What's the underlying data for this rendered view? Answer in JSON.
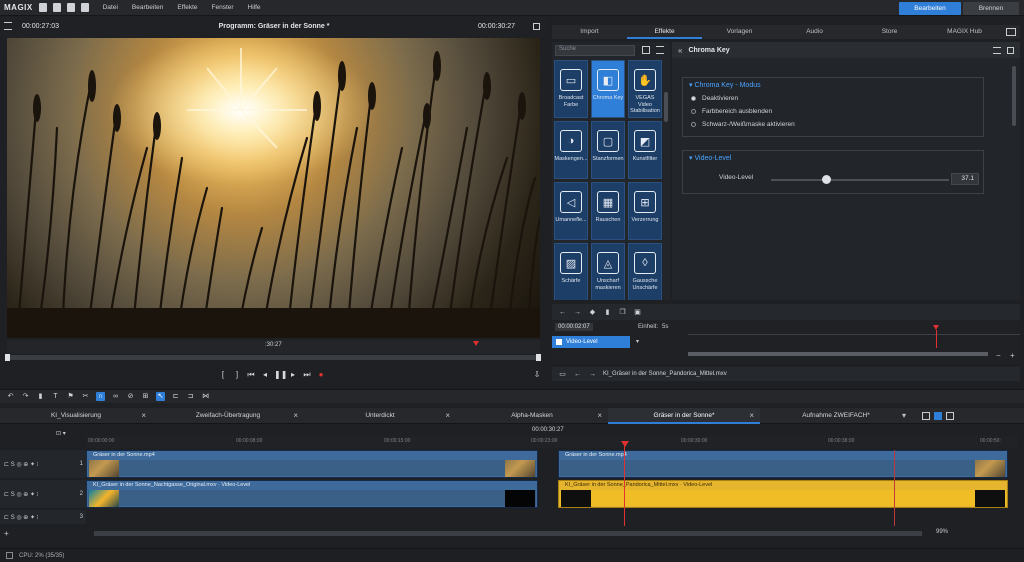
{
  "menubar": {
    "logo": "MAGIX",
    "items": [
      "Datei",
      "Bearbeiten",
      "Effekte",
      "Fenster",
      "Hilfe"
    ],
    "edit_button": "Bearbeiten",
    "burn_button": "Brennen"
  },
  "preview": {
    "timecode_left": "00:00:27:03",
    "title": "Programm: Gräser in der Sonne *",
    "timecode_right": "00:00:30:27",
    "scrub_label": ":30:27"
  },
  "right_panel": {
    "tabs": [
      "Import",
      "Effekte",
      "Vorlagen",
      "Audio",
      "Store",
      "MAGIX Hub"
    ],
    "active_tab": 1,
    "search_placeholder": "Suche",
    "effects": [
      {
        "label": "Broadcast Farbe",
        "icon": "tv-icon"
      },
      {
        "label": "Chroma Key",
        "icon": "chroma-icon",
        "selected": true
      },
      {
        "label": "VEGAS Video Stabilisation",
        "icon": "hand-icon"
      },
      {
        "label": "Maskengen...",
        "icon": "mask-icon"
      },
      {
        "label": "Stanzformen",
        "icon": "shape-icon"
      },
      {
        "label": "Kunstfilter",
        "icon": "art-icon"
      },
      {
        "label": "Umannefle...",
        "icon": "reflect-icon"
      },
      {
        "label": "Rauschen",
        "icon": "noise-icon"
      },
      {
        "label": "Verzerrung",
        "icon": "distort-icon"
      },
      {
        "label": "Schärfe",
        "icon": "sharp-icon"
      },
      {
        "label": "Unscharf maskieren",
        "icon": "unsharp-icon"
      },
      {
        "label": "Gaussche Unschärfe",
        "icon": "drop-icon"
      }
    ],
    "chroma": {
      "title": "Chroma Key",
      "mode_title": "Chroma Key - Modus",
      "options": [
        "Deaktivieren",
        "Farbbereich ausblenden",
        "Schwarz-/Weißmaske aktivieren"
      ],
      "selected_option": 0,
      "level_title": "Video-Level",
      "level_label": "Video-Level",
      "level_value": "37.1",
      "level_fraction": 0.31
    },
    "keyframe": {
      "timecode": "00:00:02:07",
      "unit_label": "Einheit:",
      "unit_value": "5s",
      "param": "Video-Level",
      "file_label": "KI_Gräser in der Sonne_Pandorica_Mittel.mxv"
    }
  },
  "timeline": {
    "tabs": [
      {
        "label": "KI_Visualisierung"
      },
      {
        "label": "Zweifach-Übertragung"
      },
      {
        "label": "Unterdickt"
      },
      {
        "label": "Alpha-Masken"
      },
      {
        "label": "Gräser in der Sonne*",
        "active": true
      },
      {
        "label": "Aufnahme ZWEIFACH*"
      }
    ],
    "position": "00:00:30:27",
    "ruler": [
      "00:00:00:00",
      "00:00:08:00",
      "00:00:15:00",
      "00:00:23:00",
      "00:00:30:00",
      "00:00:38:00",
      "00:00:45:00",
      "00:00:50:"
    ],
    "tracks": [
      {
        "number": "1",
        "clips": [
          {
            "name": "Gräser in der Sonne.mp4"
          },
          {
            "name": "Gräser in der Sonne.mp4"
          }
        ]
      },
      {
        "number": "2",
        "clips": [
          {
            "name": "KI_Gräser in der Sonne_Nachtgasse_Original.mxv · Video-Level"
          },
          {
            "name": "KI_Gräser in der Sonne_Pandorica_Mittel.mxv · Video-Level"
          }
        ]
      },
      {
        "number": "3",
        "clips": []
      }
    ],
    "zoom": "99%"
  },
  "status": {
    "cpu": "CPU: 2% (35/35)"
  }
}
